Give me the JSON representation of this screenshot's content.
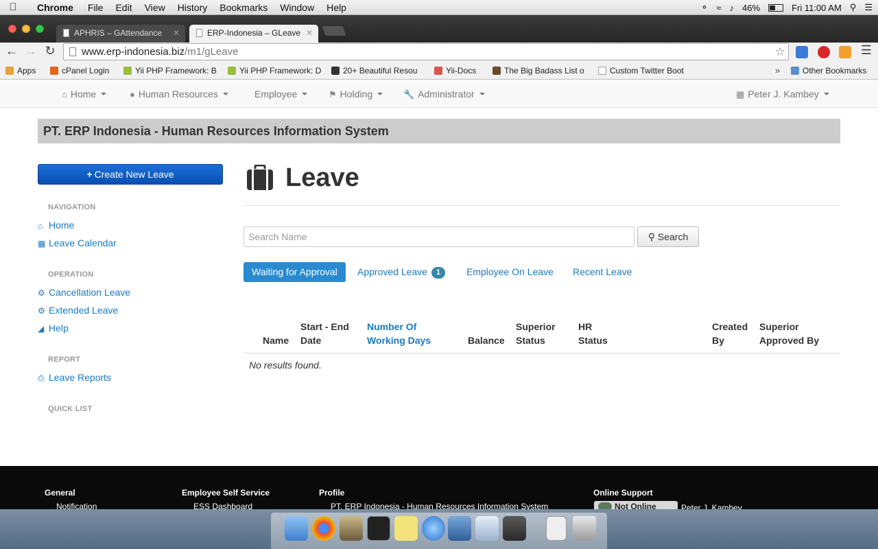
{
  "menubar": {
    "app": "Chrome",
    "items": [
      "File",
      "Edit",
      "View",
      "History",
      "Bookmarks",
      "Window",
      "Help"
    ],
    "battery": "46%",
    "battery_level": 0.46,
    "clock": "Fri 11:00 AM"
  },
  "tabs": [
    {
      "title": "APHRIS – GAttendance",
      "active": false
    },
    {
      "title": "ERP-Indonesia – GLeave",
      "active": true
    }
  ],
  "omnibox": {
    "host": "www.erp-indonesia.biz",
    "path": "/m1/gLeave"
  },
  "bookmarks": [
    "Apps",
    "cPanel Login",
    "Yii PHP Framework: B",
    "Yii PHP Framework: D",
    "20+ Beautiful Resou",
    "Yii-Docs",
    "The Big Badass List o",
    "Custom Twitter Boot"
  ],
  "bookmarks_other": "Other Bookmarks",
  "navbar": {
    "items": [
      "Home",
      "Human Resources",
      "Employee",
      "Holding",
      "Administrator"
    ],
    "user": "Peter J. Kambey"
  },
  "banner": "PT. ERP Indonesia - Human Resources Information System",
  "sidebar": {
    "create_button": "Create New Leave",
    "sections": [
      {
        "header": "NAVIGATION",
        "links": [
          "Home",
          "Leave Calendar"
        ]
      },
      {
        "header": "OPERATION",
        "links": [
          "Cancellation Leave",
          "Extended Leave",
          "Help"
        ]
      },
      {
        "header": "REPORT",
        "links": [
          "Leave Reports"
        ]
      },
      {
        "header": "QUICK LIST",
        "links": []
      }
    ]
  },
  "main": {
    "title": "Leave",
    "search": {
      "placeholder": "Search Name",
      "button": "Search"
    },
    "filter_tabs": [
      {
        "label": "Waiting for Approval",
        "active": true
      },
      {
        "label": "Approved Leave",
        "badge": "1"
      },
      {
        "label": "Employee On Leave"
      },
      {
        "label": "Recent Leave"
      }
    ],
    "table": {
      "columns": [
        {
          "line1": "",
          "line2": "Name"
        },
        {
          "line1": "Start - End",
          "line2": "Date"
        },
        {
          "line1": "Number Of",
          "line2": "Working Days"
        },
        {
          "line1": "",
          "line2": "Balance"
        },
        {
          "line1": "Superior",
          "line2": "Status"
        },
        {
          "line1": "HR",
          "line2": "Status"
        },
        {
          "line1": "Created",
          "line2": "By"
        },
        {
          "line1": "Superior",
          "line2": "Approved By"
        }
      ],
      "empty_text": "No results found."
    }
  },
  "footer": {
    "columns": [
      {
        "header": "General",
        "item": "Notification"
      },
      {
        "header": "Employee Self Service",
        "item": "ESS Dashboard"
      },
      {
        "header": "Profile",
        "item": "PT. ERP Indonesia - Human Resources Information System"
      },
      {
        "header": "Online Support",
        "item": "Peter J. Kambey"
      }
    ],
    "online_status": "Not Online"
  },
  "colors": {
    "accent": "#1a7bc1",
    "primary_button": "#0a4fb1",
    "banner_bg": "#cccccc",
    "footer_bg": "#0a0a0a"
  }
}
